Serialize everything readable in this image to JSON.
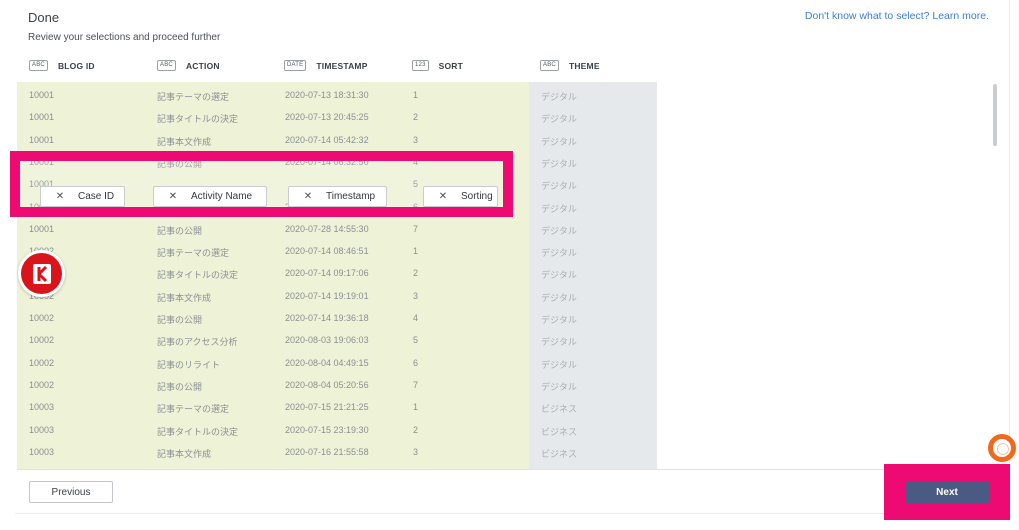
{
  "header": {
    "title": "Done",
    "subtitle": "Review your selections and proceed further",
    "help_link": "Don't know what to select? Learn more."
  },
  "columns": [
    {
      "badge": "ABC",
      "label": "BLOG ID"
    },
    {
      "badge": "ABC",
      "label": "ACTION"
    },
    {
      "badge": "DATE",
      "label": "TIMESTAMP"
    },
    {
      "badge": "123",
      "label": "SORT"
    },
    {
      "badge": "ABC",
      "label": "THEME"
    }
  ],
  "rows": [
    [
      "10001",
      "記事テーマの選定",
      "2020-07-13 18:31:30",
      "1",
      "デジタル"
    ],
    [
      "10001",
      "記事タイトルの決定",
      "2020-07-13 20:45:25",
      "2",
      "デジタル"
    ],
    [
      "10001",
      "記事本文作成",
      "2020-07-14 05:42:32",
      "3",
      "デジタル"
    ],
    [
      "10001",
      "記事の公開",
      "2020-07-14 06:32:50",
      "4",
      "デジタル"
    ],
    [
      "10001",
      "",
      "",
      "5",
      "デジタル"
    ],
    [
      "10001",
      "記事のリライト",
      "2020-07-28 14:11:50",
      "6",
      "デジタル"
    ],
    [
      "10001",
      "記事の公開",
      "2020-07-28 14:55:30",
      "7",
      "デジタル"
    ],
    [
      "10002",
      "記事テーマの選定",
      "2020-07-14 08:46:51",
      "1",
      "デジタル"
    ],
    [
      "10002",
      "記事タイトルの決定",
      "2020-07-14 09:17:06",
      "2",
      "デジタル"
    ],
    [
      "10002",
      "記事本文作成",
      "2020-07-14 19:19:01",
      "3",
      "デジタル"
    ],
    [
      "10002",
      "記事の公開",
      "2020-07-14 19:36:18",
      "4",
      "デジタル"
    ],
    [
      "10002",
      "記事のアクセス分析",
      "2020-08-03 19:06:03",
      "5",
      "デジタル"
    ],
    [
      "10002",
      "記事のリライト",
      "2020-08-04 04:49:15",
      "6",
      "デジタル"
    ],
    [
      "10002",
      "記事の公開",
      "2020-08-04 05:20:56",
      "7",
      "デジタル"
    ],
    [
      "10003",
      "記事テーマの選定",
      "2020-07-15 21:21:25",
      "1",
      "ビジネス"
    ],
    [
      "10003",
      "記事タイトルの決定",
      "2020-07-15 23:19:30",
      "2",
      "ビジネス"
    ],
    [
      "10003",
      "記事本文作成",
      "2020-07-16 21:55:58",
      "3",
      "ビジネス"
    ]
  ],
  "mappings": [
    {
      "icon": "close-icon",
      "label": "Case ID"
    },
    {
      "icon": "close-icon",
      "label": "Activity Name"
    },
    {
      "icon": "close-icon",
      "label": "Timestamp"
    },
    {
      "icon": "close-icon",
      "label": "Sorting"
    }
  ],
  "footer": {
    "previous_label": "Previous",
    "next_label": "Next"
  },
  "colors": {
    "highlight": "#ee0a73",
    "primary_button": "#4a5a82",
    "link": "#3b7ed6",
    "mapped_columns_bg": "#eef2d6",
    "unmapped_column_bg": "#e6e9ec"
  }
}
